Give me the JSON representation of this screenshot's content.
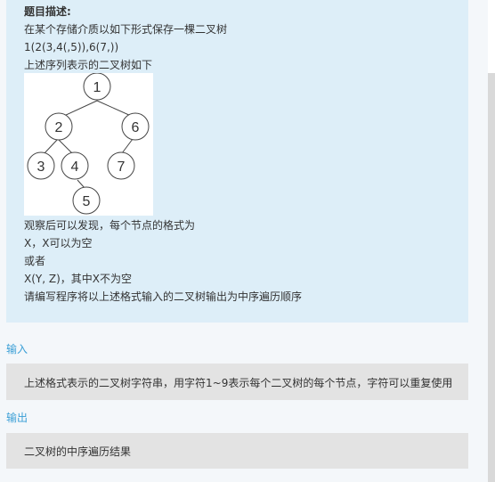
{
  "problem": {
    "title": "题目描述:",
    "lines": [
      "在某个存储介质以如下形式保存一棵二叉树",
      "1(2(3,4(,5)),6(7,))",
      "上述序列表示的二叉树如下",
      "观察后可以发现，每个节点的格式为",
      "X，X可以为空",
      "或者",
      "X(Y, Z)，其中X不为空",
      "请编写程序将以上述格式输入的二叉树输出为中序遍历顺序"
    ],
    "tree_nodes": [
      "1",
      "2",
      "6",
      "3",
      "4",
      "7",
      "5"
    ]
  },
  "input_section": {
    "title": "输入",
    "content": "上述格式表示的二叉树字符串，用字符1~9表示每个二叉树的每个节点，字符可以重复使用"
  },
  "output_section": {
    "title": "输出",
    "content": "二叉树的中序遍历结果"
  }
}
